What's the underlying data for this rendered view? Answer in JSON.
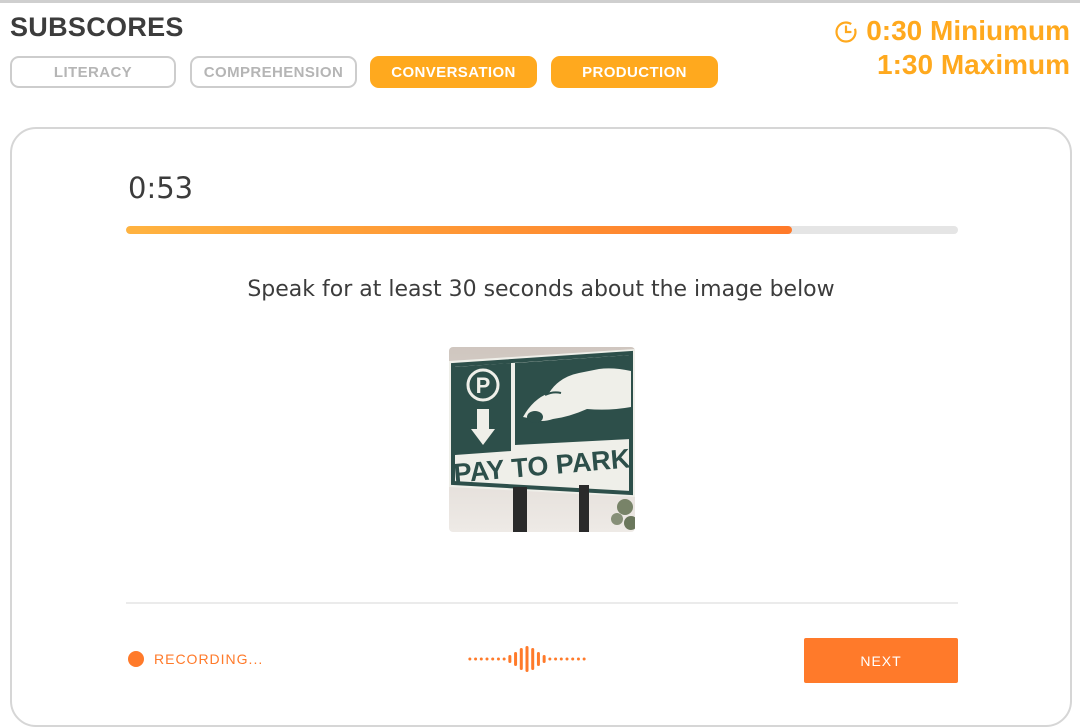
{
  "header": {
    "title": "SUBSCORES",
    "tabs": [
      {
        "label": "LITERACY",
        "active": false
      },
      {
        "label": "COMPREHENSION",
        "active": false
      },
      {
        "label": "CONVERSATION",
        "active": true
      },
      {
        "label": "PRODUCTION",
        "active": true
      }
    ],
    "time_limits": {
      "minimum": "0:30 Miniumum",
      "maximum": "1:30 Maximum",
      "icon": "clock-icon"
    }
  },
  "task": {
    "timer": "0:53",
    "progress": 0.8,
    "prompt": "Speak for at least 30 seconds about the image below",
    "image": {
      "description_icon": "parking-sign-photo",
      "sign_text": "PAY TO PARK",
      "sign_symbol": "P"
    }
  },
  "footer": {
    "recording_label": "RECORDING...",
    "next_label": "NEXT"
  },
  "colors": {
    "accent_orange": "#ffa91e",
    "button_orange": "#ff7a2a",
    "text_dark": "#3c3c3c",
    "tab_inactive": "#b5b5b5"
  }
}
